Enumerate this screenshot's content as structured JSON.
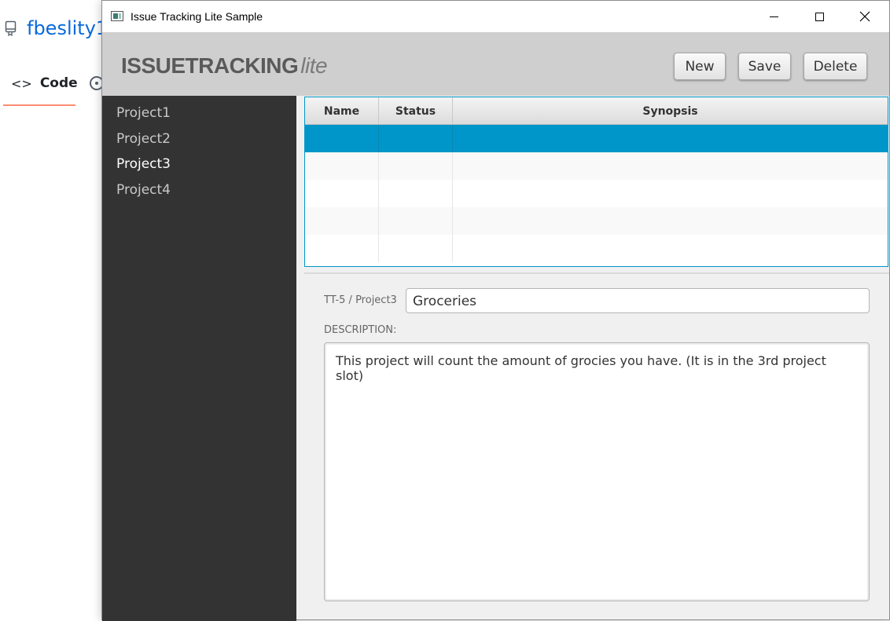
{
  "background_page": {
    "repo_name": "fbeslity1",
    "tab_code_label": "Code",
    "tab_code_icon": "code-brackets-icon",
    "tab_issues_icon": "issue-circle-icon"
  },
  "window": {
    "title": "Issue Tracking Lite Sample",
    "controls": [
      "minimize-icon",
      "maximize-icon",
      "close-icon"
    ]
  },
  "header": {
    "logo_strong": "ISSUETRACKING",
    "logo_lite": "lite",
    "buttons": {
      "new": "New",
      "save": "Save",
      "delete": "Delete"
    }
  },
  "sidebar": {
    "projects": [
      {
        "label": "Project1",
        "selected": false
      },
      {
        "label": "Project2",
        "selected": false
      },
      {
        "label": "Project3",
        "selected": true
      },
      {
        "label": "Project4",
        "selected": false
      }
    ]
  },
  "table": {
    "columns": [
      "Name",
      "Status",
      "Synopsis"
    ],
    "rows": [
      {
        "name": "",
        "status": "",
        "synopsis": "",
        "selected": true
      },
      {
        "name": "",
        "status": "",
        "synopsis": "",
        "selected": false
      },
      {
        "name": "",
        "status": "",
        "synopsis": "",
        "selected": false
      },
      {
        "name": "",
        "status": "",
        "synopsis": "",
        "selected": false
      },
      {
        "name": "",
        "status": "",
        "synopsis": "",
        "selected": false
      }
    ]
  },
  "details": {
    "issue_id": "TT-5 / Project3",
    "synopsis_value": "Groceries",
    "description_label": "DESCRIPTION:",
    "description_value": "This project will count the amount of grocies you have. (It is in the 3rd project slot)"
  },
  "colors": {
    "selection_accent": "#0096c9",
    "sidebar_bg": "#333333",
    "header_bg": "#cfcfcf",
    "link_blue": "#0969da"
  }
}
